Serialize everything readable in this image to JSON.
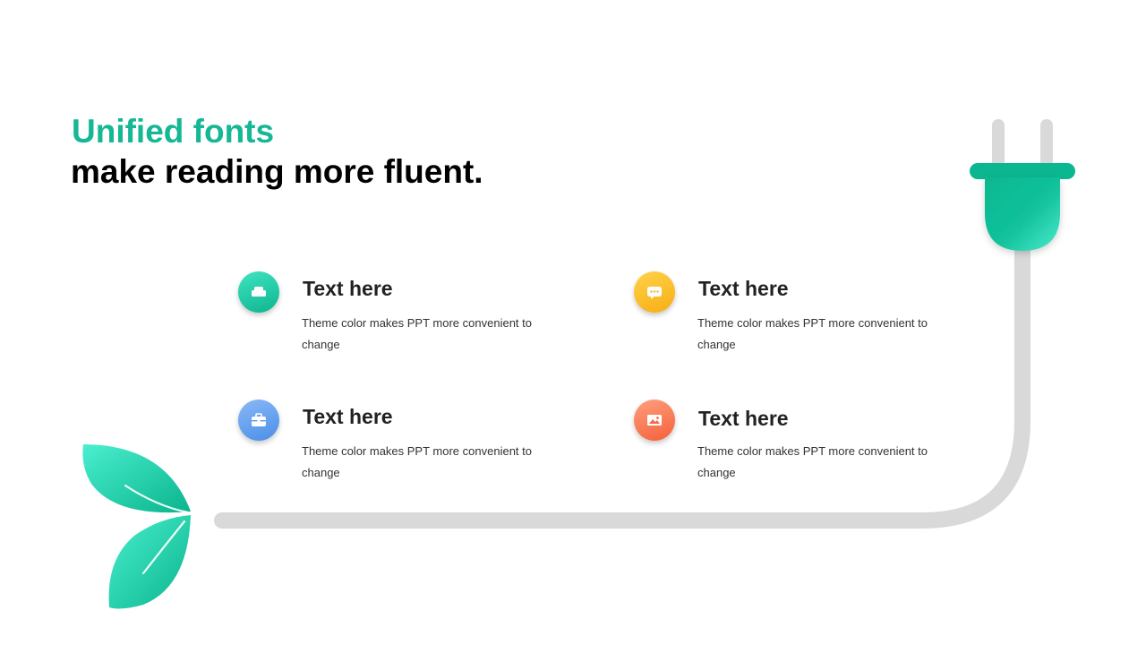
{
  "title": {
    "accent": "Unified fonts",
    "main": "make reading more fluent."
  },
  "items": [
    {
      "heading": "Text here",
      "desc": "Theme  color makes PPT more convenient to change",
      "icon": "sofa-icon",
      "color": "#16b795"
    },
    {
      "heading": "Text here",
      "desc": "Theme  color makes PPT more convenient to change",
      "icon": "chat-bubble-icon",
      "color": "#f7b51f"
    },
    {
      "heading": "Text here",
      "desc": "Theme  color makes PPT more convenient to change",
      "icon": "briefcase-icon",
      "color": "#5a9cf0"
    },
    {
      "heading": "Text here",
      "desc": "Theme  color makes PPT more convenient to change",
      "icon": "image-icon",
      "color": "#f76a45"
    }
  ],
  "colors": {
    "accent": "#16b795",
    "cable": "#d9d9d9"
  }
}
